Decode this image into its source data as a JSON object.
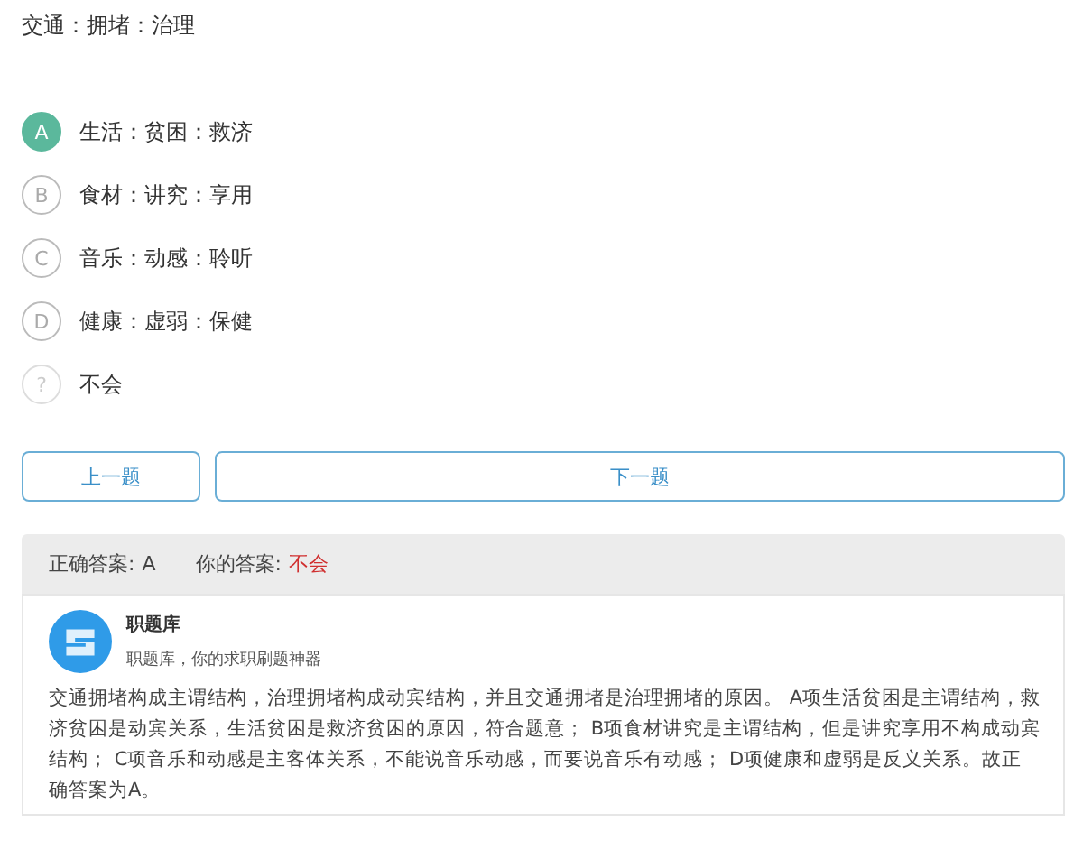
{
  "question": "交通：拥堵：治理",
  "options": [
    {
      "kind": "letter",
      "mark": "A",
      "text": "生活：贫困：救济",
      "selected": true
    },
    {
      "kind": "letter",
      "mark": "B",
      "text": "食材：讲究：享用",
      "selected": false
    },
    {
      "kind": "letter",
      "mark": "C",
      "text": "音乐：动感：聆听",
      "selected": false
    },
    {
      "kind": "letter",
      "mark": "D",
      "text": "健康：虚弱：保健",
      "selected": false
    },
    {
      "kind": "unknown",
      "mark": "?",
      "text": "不会",
      "selected": false
    }
  ],
  "buttons": {
    "prev": "上一题",
    "next": "下一题"
  },
  "result": {
    "correct_label": "正确答案:",
    "correct": "A",
    "yours_label": "你的答案:",
    "yours": "不会"
  },
  "source": {
    "name": "职题库",
    "tagline": "职题库，你的求职刷题神器"
  },
  "explanation": "交通拥堵构成主谓结构，治理拥堵构成动宾结构，并且交通拥堵是治理拥堵的原因。 A项生活贫困是主谓结构，救济贫困是动宾关系，生活贫困是救济贫困的原因，符合题意； B项食材讲究是主谓结构，但是讲究享用不构成动宾结构； C项音乐和动感是主客体关系，不能说音乐动感，而要说音乐有动感； D项健康和虚弱是反义关系。故正确答案为A。"
}
